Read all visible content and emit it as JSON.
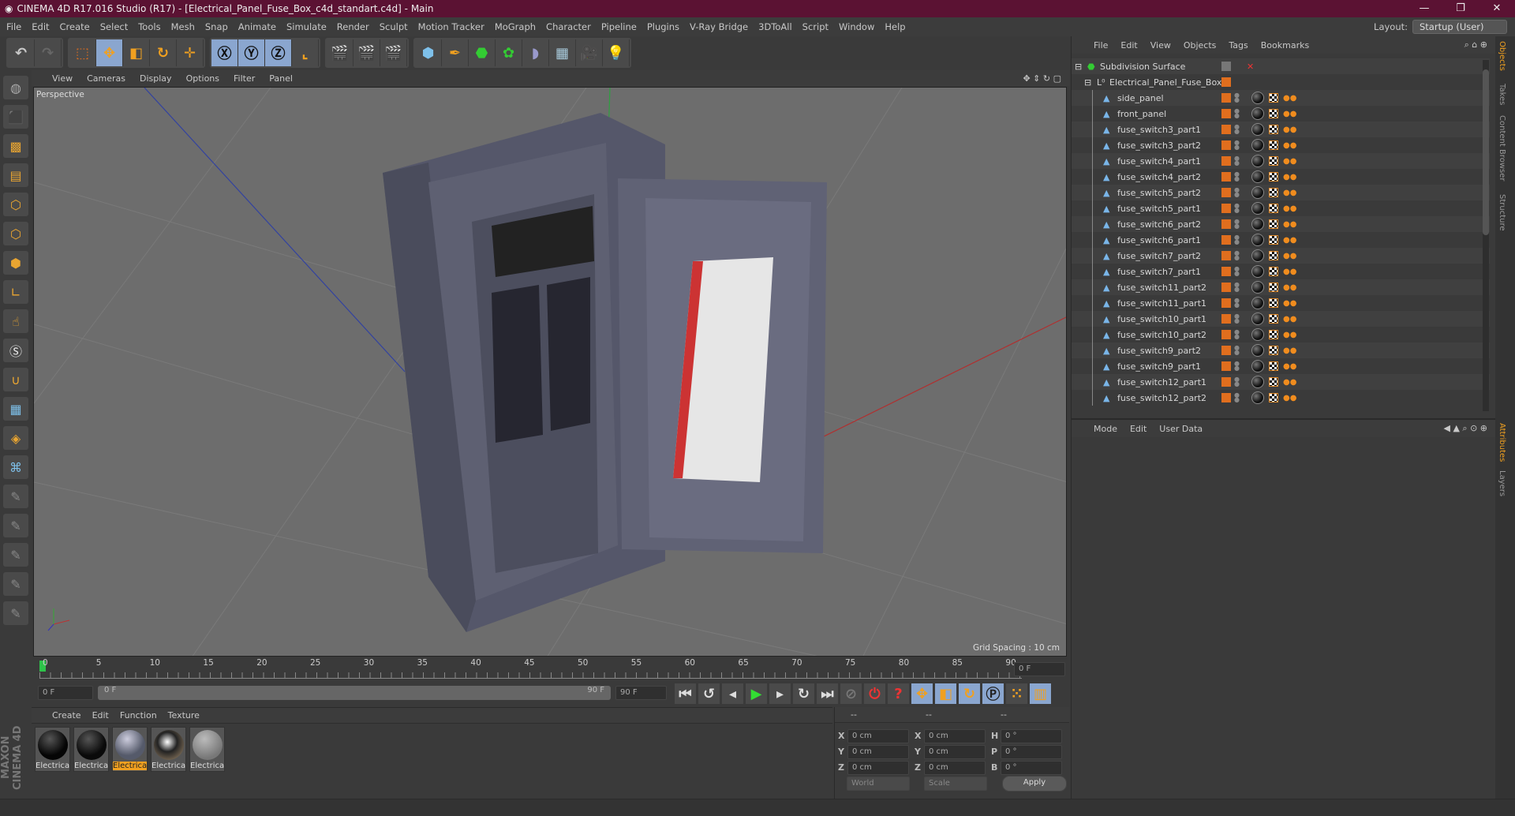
{
  "window": {
    "title": "CINEMA 4D R17.016 Studio (R17) - [Electrical_Panel_Fuse_Box_c4d_standart.c4d] - Main"
  },
  "menu": [
    "File",
    "Edit",
    "Create",
    "Select",
    "Tools",
    "Mesh",
    "Snap",
    "Animate",
    "Simulate",
    "Render",
    "Sculpt",
    "Motion Tracker",
    "MoGraph",
    "Character",
    "Pipeline",
    "Plugins",
    "V-Ray Bridge",
    "3DToAll",
    "Script",
    "Window",
    "Help"
  ],
  "layout": {
    "label": "Layout:",
    "value": "Startup (User)"
  },
  "viewport": {
    "menu": [
      "View",
      "Cameras",
      "Display",
      "Options",
      "Filter",
      "Panel"
    ],
    "name": "Perspective",
    "grid_spacing": "Grid Spacing : 10 cm"
  },
  "timeline": {
    "ticks": [
      "0",
      "5",
      "10",
      "15",
      "20",
      "25",
      "30",
      "35",
      "40",
      "45",
      "50",
      "55",
      "60",
      "65",
      "70",
      "75",
      "80",
      "85",
      "90"
    ],
    "current": "0 F",
    "start": "0 F",
    "range_start": "0 F",
    "range_end": "90 F",
    "end": "90 F"
  },
  "materials": {
    "menu": [
      "Create",
      "Edit",
      "Function",
      "Texture"
    ],
    "items": [
      "Electrica",
      "Electrica",
      "Electrica",
      "Electrica",
      "Electrica"
    ]
  },
  "coords": {
    "headers": [
      "--",
      "--",
      "--"
    ],
    "rows": [
      [
        "X",
        "0 cm",
        "X",
        "0 cm",
        "H",
        "0 °"
      ],
      [
        "Y",
        "0 cm",
        "Y",
        "0 cm",
        "P",
        "0 °"
      ],
      [
        "Z",
        "0 cm",
        "Z",
        "0 cm",
        "B",
        "0 °"
      ]
    ],
    "mode": "World",
    "scale": "Scale",
    "apply": "Apply"
  },
  "objects": {
    "menu": [
      "File",
      "Edit",
      "View",
      "Objects",
      "Tags",
      "Bookmarks"
    ],
    "root": "Subdivision Surface",
    "group": "Electrical_Panel_Fuse_Box",
    "items": [
      "side_panel",
      "front_panel",
      "fuse_switch3_part1",
      "fuse_switch3_part2",
      "fuse_switch4_part1",
      "fuse_switch4_part2",
      "fuse_switch5_part2",
      "fuse_switch5_part1",
      "fuse_switch6_part2",
      "fuse_switch6_part1",
      "fuse_switch7_part2",
      "fuse_switch7_part1",
      "fuse_switch11_part2",
      "fuse_switch11_part1",
      "fuse_switch10_part1",
      "fuse_switch10_part2",
      "fuse_switch9_part2",
      "fuse_switch9_part1",
      "fuse_switch12_part1",
      "fuse_switch12_part2"
    ]
  },
  "attributes": {
    "menu": [
      "Mode",
      "Edit",
      "User Data"
    ]
  },
  "right_tabs": [
    "Objects",
    "Takes",
    "Content Browser",
    "Structure",
    "Attributes",
    "Layers"
  ],
  "colors": {
    "title": "#5b1233",
    "accent": "#e06e1e",
    "selected": "#f0a020"
  }
}
